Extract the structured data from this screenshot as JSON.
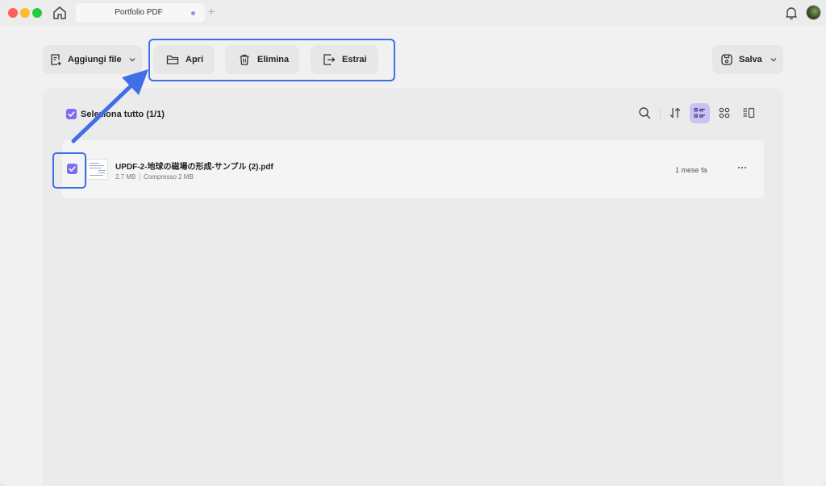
{
  "window": {
    "tab_title": "Portfolio PDF",
    "new_tab": "+"
  },
  "toolbar": {
    "add_file_label": "Aggiungi file",
    "open_label": "Apri",
    "delete_label": "Elimina",
    "extract_label": "Estrai",
    "save_label": "Salva"
  },
  "list": {
    "select_all_label": "Seleziona tutto (1/1)",
    "files": [
      {
        "name": "UPDF-2-地球の磁場の形成-サンプル (2).pdf",
        "size": "2.7 MB",
        "compressed": "Compresso 2 MB",
        "modified": "1 mese fa",
        "more": "···"
      }
    ]
  },
  "colors": {
    "accent": "#7b6ef0",
    "highlight": "#3f6fe6",
    "active_view_bg": "#c9c3f5"
  },
  "icons": {
    "home": "home-icon",
    "bell": "bell-icon",
    "add_file": "add-file-icon",
    "open": "folder-icon",
    "delete": "trash-icon",
    "extract": "extract-icon",
    "save": "save-icon",
    "search": "search-icon",
    "sort": "sort-icon",
    "list_view": "list-view-icon",
    "grid_view": "grid-view-icon",
    "detail_view": "detail-view-icon"
  }
}
